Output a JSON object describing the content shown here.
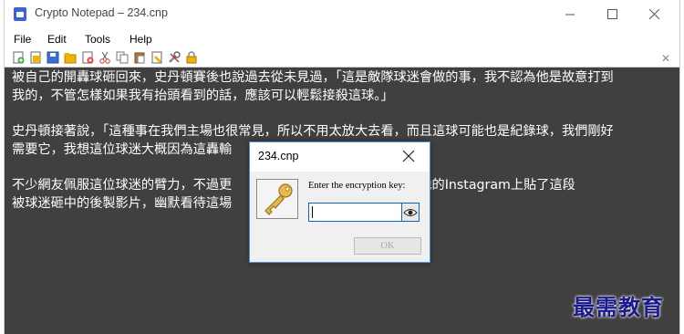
{
  "window": {
    "title": "Crypto Notepad – 234.cnp"
  },
  "menu": {
    "items": [
      "File",
      "Edit",
      "Tools",
      "Help"
    ]
  },
  "toolbar": {
    "icons": [
      "new-file-icon",
      "open-file-icon",
      "save-icon",
      "save-as-icon",
      "delete-icon",
      "cut-icon",
      "copy-icon",
      "paste-icon",
      "pin-icon",
      "tools-icon",
      "lock-icon"
    ],
    "close_glyph": "✕"
  },
  "editor": {
    "paragraphs": [
      [
        "被自己的開轟球砸回來，史丹頓賽後也說過去從未見過，「這是敵隊球迷會做的事，我不認為他是故意打到",
        "我的，不管怎樣如果我有抬頭看到的話，應該可以輕鬆接殺這球。」"
      ],
      [
        "史丹頓接著說，「這種事在我們主場也很常見，所以不用太放大去看，而且這球可能也是紀錄球，我們剛好",
        "需要它，我想這位球迷大概因為這轟輸"
      ],
      [
        "不少網友佩服這位球迷的臂力，不過更",
        "頓稍後甚至在他的Instagram上貼了這段",
        "被球迷砸中的後製影片，幽默看待這場"
      ]
    ],
    "background": "#404040"
  },
  "dialog": {
    "title": "234.cnp",
    "label": "Enter the encryption key:",
    "input_value": "",
    "ok_label": "OK",
    "border_color": "#4a90d9"
  },
  "watermark": {
    "text": "最需教育"
  }
}
